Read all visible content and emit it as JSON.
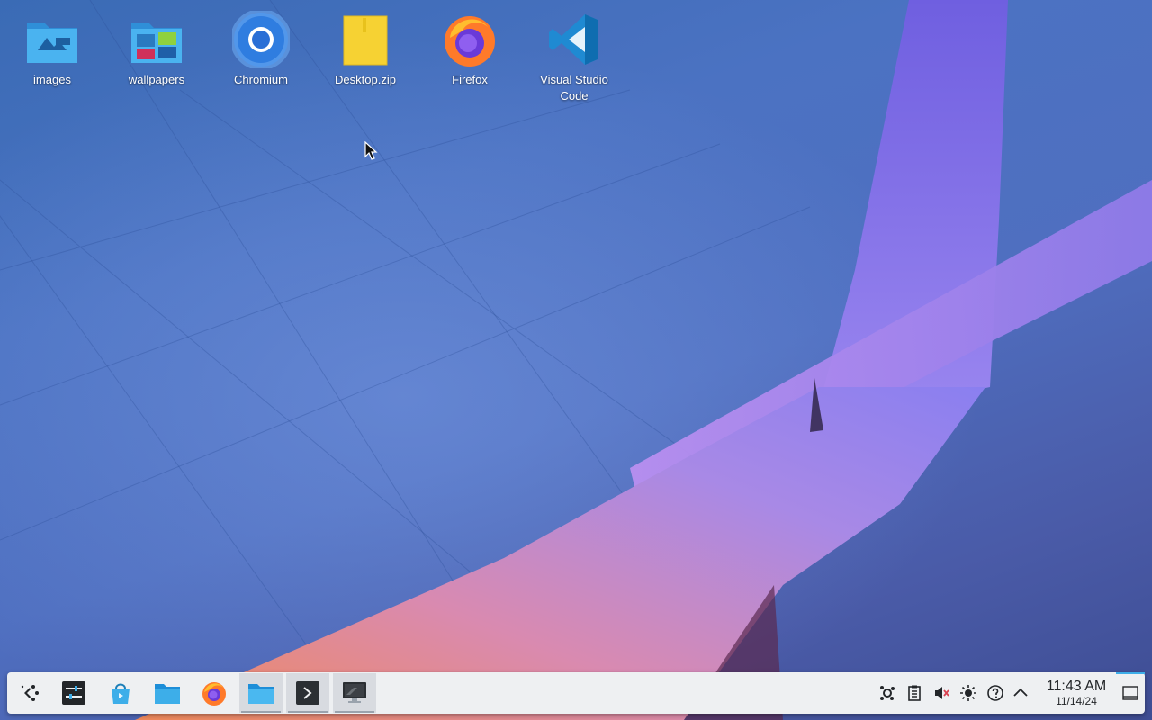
{
  "desktop": {
    "icons": [
      {
        "label": "images",
        "icon": "folder-images-icon"
      },
      {
        "label": "wallpapers",
        "icon": "folder-wallpapers-icon"
      },
      {
        "label": "Chromium",
        "icon": "chromium-icon"
      },
      {
        "label": "Desktop.zip",
        "icon": "zip-archive-icon"
      },
      {
        "label": "Firefox",
        "icon": "firefox-icon"
      },
      {
        "label": "Visual Studio Code",
        "icon": "vscode-icon"
      }
    ]
  },
  "taskbar": {
    "launchers": [
      {
        "icon": "application-launcher-icon"
      },
      {
        "icon": "system-settings-icon"
      },
      {
        "icon": "discover-store-icon"
      },
      {
        "icon": "dolphin-file-manager-icon"
      },
      {
        "icon": "firefox-icon"
      },
      {
        "icon": "file-manager-window-icon",
        "active": true
      },
      {
        "icon": "konsole-terminal-icon",
        "active": true
      },
      {
        "icon": "screen-window-icon",
        "active": true
      }
    ],
    "tray": [
      {
        "icon": "kde-connect-icon"
      },
      {
        "icon": "clipboard-icon"
      },
      {
        "icon": "volume-muted-icon"
      },
      {
        "icon": "brightness-icon"
      },
      {
        "icon": "help-icon"
      },
      {
        "icon": "chevron-up-icon"
      }
    ],
    "clock": {
      "time": "11:43 AM",
      "date": "11/14/24"
    },
    "show_desktop_icon": "show-desktop-icon"
  },
  "colors": {
    "accent": "#3daee9",
    "panel_bg": "#eef0f2",
    "text_dark": "#232629"
  }
}
